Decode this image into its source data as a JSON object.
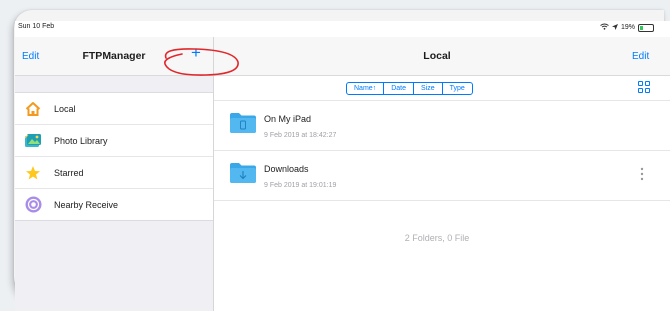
{
  "status_bar": {
    "time": "Sun 10 Feb",
    "battery": "19%"
  },
  "sidebar": {
    "edit_label": "Edit",
    "title": "FTPManager",
    "add_label": "+",
    "items": [
      {
        "label": "Local",
        "icon": "house-icon"
      },
      {
        "label": "Photo Library",
        "icon": "photo-library-icon"
      },
      {
        "label": "Starred",
        "icon": "star-icon"
      },
      {
        "label": "Nearby Receive",
        "icon": "nearby-receive-icon"
      }
    ]
  },
  "main": {
    "title": "Local",
    "edit_label": "Edit",
    "sort_options": [
      "Name↑",
      "Date",
      "Size",
      "Type"
    ],
    "files": [
      {
        "name": "On My iPad",
        "date": "9 Feb 2019 at 18:42:27",
        "icon": "folder-device-icon"
      },
      {
        "name": "Downloads",
        "date": "9 Feb 2019 at 19:01:19",
        "icon": "folder-download-icon"
      }
    ],
    "summary": "2 Folders, 0 File"
  },
  "colors": {
    "accent": "#007aff",
    "folder": "#3aa8e8",
    "annotation": "#e0272b"
  }
}
